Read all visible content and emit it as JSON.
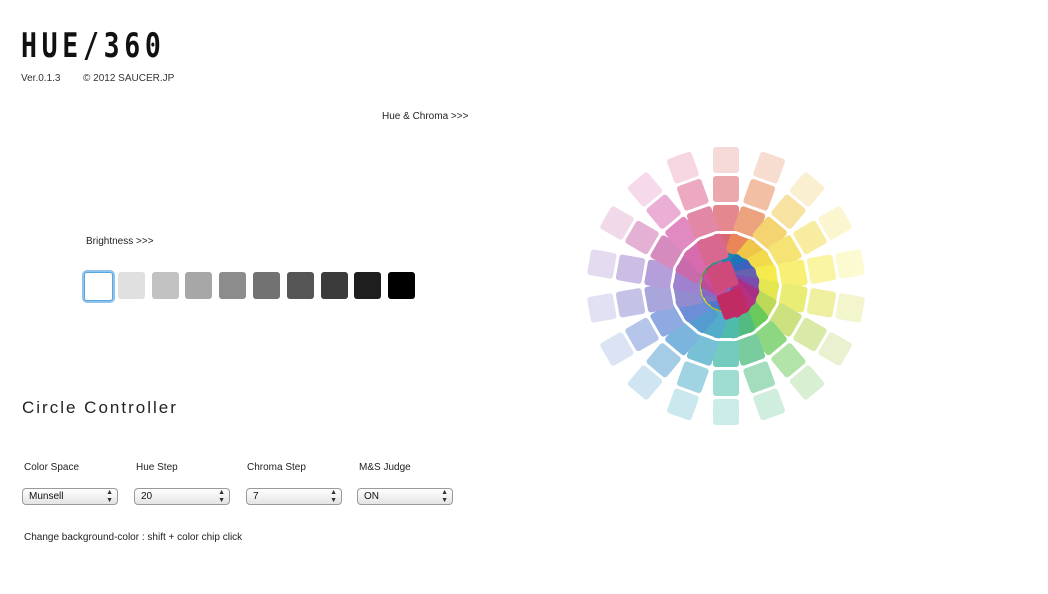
{
  "app": {
    "title": "HUE/360",
    "version": "Ver.0.1.3",
    "copyright": "© 2012 SAUCER.JP"
  },
  "labels": {
    "hue_chroma": "Hue & Chroma >>>",
    "brightness": "Brightness >>>"
  },
  "brightness": {
    "selected_index": 0,
    "chips": [
      "#ffffff",
      "#e0e0e0",
      "#c2c2c2",
      "#a7a7a7",
      "#8c8c8c",
      "#727272",
      "#555555",
      "#3b3b3b",
      "#1e1e1e",
      "#000000"
    ]
  },
  "controller": {
    "title": "Circle Controller",
    "fields": [
      {
        "label": "Color Space",
        "value": "Munsell"
      },
      {
        "label": "Hue Step",
        "value": "20"
      },
      {
        "label": "Chroma Step",
        "value": "7"
      },
      {
        "label": "M&S Judge",
        "value": "ON"
      }
    ],
    "hint": "Change background-color : shift + color chip click"
  },
  "wheel": {
    "hue_step": 20,
    "chroma_step": 7,
    "spokes": [
      {
        "angle": 0,
        "colors": [
          "#f6dada",
          "#eba9ae",
          "#e4878f",
          "#da6873",
          "#d14a56",
          "#c3253a"
        ]
      },
      {
        "angle": 20,
        "colors": [
          "#f7ddd0",
          "#f2bfa4",
          "#eda27e",
          "#e88559",
          "#e46b34",
          "#de5510"
        ]
      },
      {
        "angle": 40,
        "colors": [
          "#faefcf",
          "#f7e2a1",
          "#f3d470",
          "#f0c64a",
          "#ecb925",
          "#e9ad0c"
        ]
      },
      {
        "angle": 60,
        "colors": [
          "#fbf6d0",
          "#f8eca0",
          "#f5e373",
          "#f3da4b",
          "#f0d222",
          "#eecb0b"
        ]
      },
      {
        "angle": 80,
        "colors": [
          "#fcfad1",
          "#faf5a2",
          "#f8ef75",
          "#f6eb4d",
          "#f4e526",
          "#f2e10d"
        ]
      },
      {
        "angle": 100,
        "colors": [
          "#f3f5cd",
          "#eef0a0",
          "#e9ec75",
          "#e4e74f",
          "#e0e329",
          "#dcdf0e"
        ]
      },
      {
        "angle": 120,
        "colors": [
          "#e9f1d0",
          "#d8e9a8",
          "#cce281",
          "#bcd95a",
          "#aecf33",
          "#a3c810"
        ]
      },
      {
        "angle": 140,
        "colors": [
          "#d8efd2",
          "#b2e3a9",
          "#8dd782",
          "#69ca5b",
          "#46be36",
          "#2fb317"
        ]
      },
      {
        "angle": 160,
        "colors": [
          "#cfeedd",
          "#a3ddbd",
          "#78cc9e",
          "#52bb80",
          "#35a866",
          "#1f954f"
        ]
      },
      {
        "angle": 180,
        "colors": [
          "#cbece8",
          "#9fdcd1",
          "#74ccbe",
          "#4fbcab",
          "#35ab98",
          "#1f9b86"
        ]
      },
      {
        "angle": 200,
        "colors": [
          "#cbe8ef",
          "#a1d4e2",
          "#78c0d6",
          "#52acca",
          "#3597bd",
          "#1e85b1"
        ]
      },
      {
        "angle": 220,
        "colors": [
          "#d0e5f2",
          "#a5cce7",
          "#7bb4dc",
          "#549cd0",
          "#3285c5",
          "#1c74bb"
        ]
      },
      {
        "angle": 240,
        "colors": [
          "#dbe3f4",
          "#b5c6ea",
          "#8faae0",
          "#6d8ed6",
          "#4e74cb",
          "#3b63bd"
        ]
      },
      {
        "angle": 260,
        "colors": [
          "#e1e1f3",
          "#c4c3e7",
          "#a9a6db",
          "#928ccf",
          "#7c75c0",
          "#6762b0"
        ]
      },
      {
        "angle": 280,
        "colors": [
          "#e4dbf1",
          "#ccbde5",
          "#b49fda",
          "#9e82cf",
          "#8b66c4",
          "#7a4cb0"
        ]
      },
      {
        "angle": 300,
        "colors": [
          "#f2d9ea",
          "#e4b0d3",
          "#d68bbf",
          "#c86aab",
          "#b94d98",
          "#a53086"
        ]
      },
      {
        "angle": 320,
        "colors": [
          "#f6d9ea",
          "#ebaed4",
          "#e18ac1",
          "#d66bae",
          "#cc4c9b",
          "#b6307f"
        ]
      },
      {
        "angle": 340,
        "colors": [
          "#f6d6e1",
          "#eca9c1",
          "#e387a7",
          "#d96890",
          "#ce4a7a",
          "#c12b63"
        ]
      }
    ]
  }
}
